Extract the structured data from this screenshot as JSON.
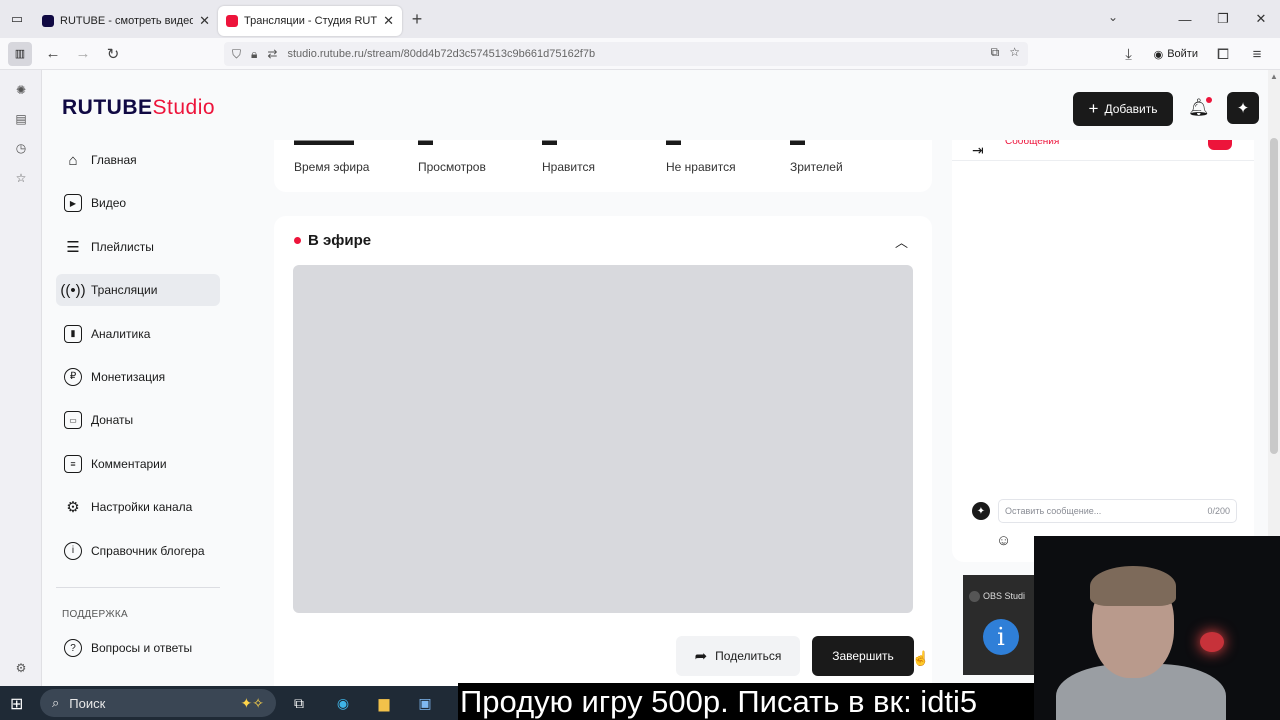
{
  "browser": {
    "tabs": [
      {
        "title": "RUTUBE - смотреть видео онл",
        "favicon_color": "#100943"
      },
      {
        "title": "Трансляции - Студия RUTUBE",
        "favicon_color": "#ed143b"
      }
    ],
    "url": "studio.rutube.ru/stream/80dd4b72d3c574513c9b661d75162f7b",
    "login_label": "Войти"
  },
  "header": {
    "logo_primary": "RUTUBE",
    "logo_secondary": "Studio",
    "add_label": "Добавить"
  },
  "nav": {
    "items": [
      {
        "label": "Главная",
        "icon": "home-icon"
      },
      {
        "label": "Видео",
        "icon": "video-icon"
      },
      {
        "label": "Плейлисты",
        "icon": "playlist-icon"
      },
      {
        "label": "Трансляции",
        "icon": "broadcast-icon",
        "active": true
      },
      {
        "label": "Аналитика",
        "icon": "chart-icon"
      },
      {
        "label": "Монетизация",
        "icon": "ruble-icon"
      },
      {
        "label": "Донаты",
        "icon": "wallet-icon"
      },
      {
        "label": "Комментарии",
        "icon": "comment-icon"
      },
      {
        "label": "Настройки канала",
        "icon": "gear-icon"
      },
      {
        "label": "Справочник блогера",
        "icon": "info-icon"
      }
    ],
    "support_title": "ПОДДЕРЖКА",
    "faq_label": "Вопросы и ответы"
  },
  "stats": [
    {
      "label": "Время эфира"
    },
    {
      "label": "Просмотров"
    },
    {
      "label": "Нравится"
    },
    {
      "label": "Не нравится"
    },
    {
      "label": "Зрителей"
    }
  ],
  "live": {
    "title": "В эфире",
    "share_label": "Поделиться",
    "finish_label": "Завершить"
  },
  "chat": {
    "tab_label": "Сообщения",
    "placeholder": "Оставить сообщение...",
    "counter": "0/200"
  },
  "taskbar": {
    "search_label": "Поиск"
  },
  "overlay": {
    "ticker": "Продую игру 500р. Писать в вк: idti5",
    "obs_label": "OBS Studi",
    "obs_info": "i"
  },
  "colors": {
    "brand_red": "#ed143b",
    "brand_dark": "#100943",
    "button_dark": "#1a1a1a"
  }
}
